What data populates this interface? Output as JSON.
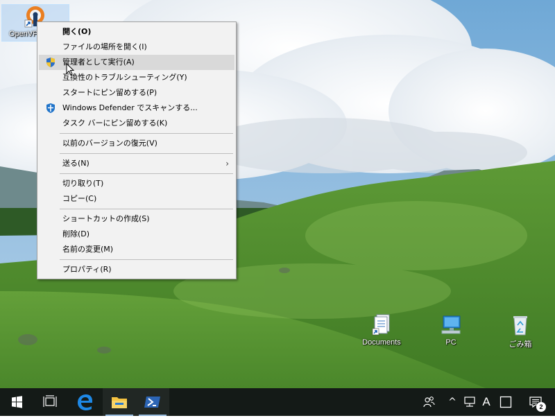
{
  "desktop": {
    "icons": [
      {
        "label": "OpenVPN",
        "icon": "openvpn-icon"
      },
      {
        "label": "Documents",
        "icon": "documents-icon"
      },
      {
        "label": "PC",
        "icon": "pc-icon"
      },
      {
        "label": "ごみ箱",
        "icon": "recycle-bin-icon"
      }
    ]
  },
  "context_menu": {
    "items": [
      {
        "label": "開く(O)",
        "bold": true
      },
      {
        "label": "ファイルの場所を開く(I)"
      },
      {
        "label": "管理者として実行(A)",
        "icon": "uac-shield-icon",
        "highlighted": true
      },
      {
        "label": "互換性のトラブルシューティング(Y)"
      },
      {
        "label": "スタートにピン留めする(P)"
      },
      {
        "label": "Windows Defender でスキャンする...",
        "icon": "defender-icon"
      },
      {
        "label": "タスク バーにピン留めする(K)"
      },
      {
        "label": "以前のバージョンの復元(V)"
      },
      {
        "label": "送る(N)",
        "submenu": true
      },
      {
        "label": "切り取り(T)"
      },
      {
        "label": "コピー(C)"
      },
      {
        "label": "ショートカットの作成(S)"
      },
      {
        "label": "削除(D)"
      },
      {
        "label": "名前の変更(M)"
      },
      {
        "label": "プロパティ(R)"
      }
    ],
    "submenu_arrow": "›"
  },
  "taskbar": {
    "buttons": [
      {
        "icon": "windows-start-icon"
      },
      {
        "icon": "task-view-icon"
      },
      {
        "icon": "edge-icon"
      },
      {
        "icon": "file-explorer-icon"
      },
      {
        "icon": "powershell-icon"
      }
    ],
    "tray": {
      "people_icon": "people-icon",
      "chevron": "^",
      "network_icon": "network-icon",
      "ime_mode": "A",
      "notifications_count": "2"
    }
  },
  "colors": {
    "accent": "#8fb5d8",
    "taskbar": "#141a17",
    "menu_bg": "#f2f2f2",
    "menu_highlight": "#d9d9d9"
  }
}
